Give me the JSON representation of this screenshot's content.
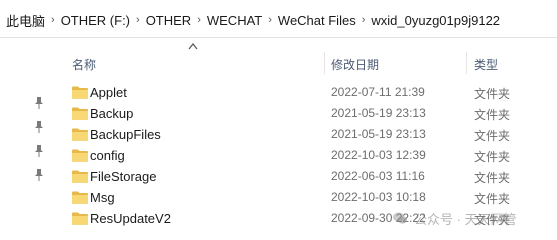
{
  "address": {
    "crumbs": [
      "此电脑",
      "OTHER (F:)",
      "OTHER",
      "WECHAT",
      "WeChat Files",
      "wxid_0yuzg01p9j9122"
    ],
    "separator": "›"
  },
  "header": {
    "name_label": "名称",
    "date_label": "修改日期",
    "type_label": "类型"
  },
  "rows": [
    {
      "name": "Applet",
      "date": "2022-07-11 21:39",
      "type": "文件夹"
    },
    {
      "name": "Backup",
      "date": "2021-05-19 23:13",
      "type": "文件夹"
    },
    {
      "name": "BackupFiles",
      "date": "2021-05-19 23:13",
      "type": "文件夹"
    },
    {
      "name": "config",
      "date": "2022-10-03 12:39",
      "type": "文件夹"
    },
    {
      "name": "FileStorage",
      "date": "2022-06-03 11:16",
      "type": "文件夹"
    },
    {
      "name": "Msg",
      "date": "2022-10-03 10:18",
      "type": "文件夹"
    },
    {
      "name": "ResUpdateV2",
      "date": "2022-09-30 22:22",
      "type": "文件夹"
    }
  ],
  "watermark": {
    "text": "公众号 · 天天网管"
  },
  "icons": {
    "folder": "folder-icon",
    "pin": "pin-icon",
    "sort": "sort-up-icon",
    "watermark_logo": "wechat-logo-icon"
  },
  "colors": {
    "folder_yellow": "#f8d775",
    "folder_dark": "#e6b94a",
    "header_text": "#4a5a75"
  }
}
